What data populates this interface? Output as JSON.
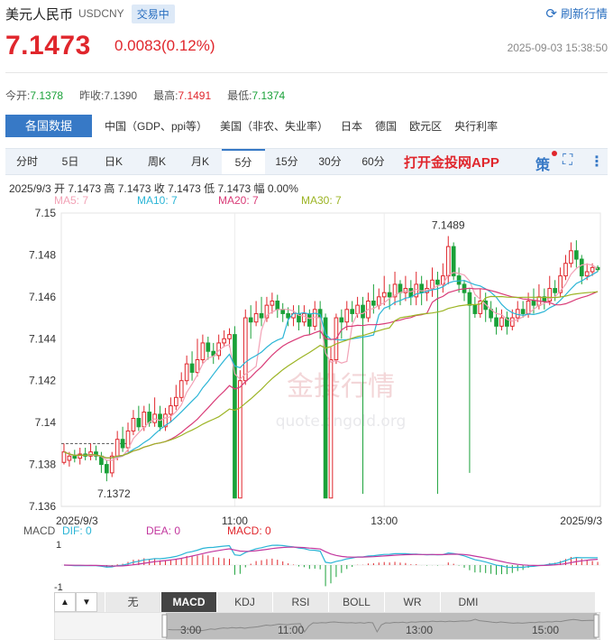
{
  "header": {
    "name": "美元人民币",
    "code": "USDCNY",
    "status": "交易中",
    "refresh_label": "刷新行情"
  },
  "quote": {
    "price": "7.1473",
    "change": "0.0083(0.12%)",
    "timestamp": "2025-09-03 15:38:50"
  },
  "stats": [
    {
      "label": "今开:",
      "value": "7.1378",
      "color": "green"
    },
    {
      "label": "昨收:",
      "value": "7.1390",
      "color": "neutral"
    },
    {
      "label": "最高:",
      "value": "7.1491",
      "color": "red"
    },
    {
      "label": "最低:",
      "value": "7.1374",
      "color": "green"
    }
  ],
  "data_tabs": {
    "active": "各国数据",
    "items": [
      "中国（GDP、ppi等）",
      "美国（非农、失业率）",
      "日本",
      "德国",
      "欧元区",
      "央行利率"
    ]
  },
  "periods": {
    "items": [
      "分时",
      "5日",
      "日K",
      "周K",
      "月K",
      "5分",
      "15分",
      "30分",
      "60分"
    ],
    "active_index": 5,
    "promo": "打开金投网APP",
    "strategy_label": "策"
  },
  "ohlc_line": "2025/9/3  开 7.1473  高 7.1473  收 7.1473  低 7.1473  幅 0.00%",
  "ma_legend": [
    {
      "label": "MA5: 7",
      "color": "#f2a2b6"
    },
    {
      "label": "MA10: 7",
      "color": "#2bb5d6"
    },
    {
      "label": "MA20: 7",
      "color": "#d93c78"
    },
    {
      "label": "MA30: 7",
      "color": "#9cb424"
    }
  ],
  "watermark": {
    "main": "金投行情",
    "sub": "quote.cngold.org"
  },
  "macd_legend": [
    {
      "label": "MACD",
      "color": "#555555"
    },
    {
      "label": "DIF: 0",
      "color": "#2bb5d6"
    },
    {
      "label": "DEA: 0",
      "color": "#c2379e"
    },
    {
      "label": "MACD: 0",
      "color": "#e0262c"
    }
  ],
  "macd_axis": [
    "1",
    "-1"
  ],
  "indicator_tabs": {
    "arrows": [
      "▲",
      "▼"
    ],
    "items": [
      "无",
      "MACD",
      "KDJ",
      "RSI",
      "BOLL",
      "WR",
      "DMI"
    ],
    "active_index": 1
  },
  "navigator": {
    "labels": [
      "3:00",
      "11:00",
      "13:00",
      "15:00"
    ]
  },
  "chart_data": {
    "type": "candlestick",
    "colors": {
      "up": "#e0262c",
      "down": "#1aa139"
    },
    "y_ticks": [
      "7.15",
      "7.148",
      "7.146",
      "7.144",
      "7.142",
      "7.14",
      "7.138",
      "7.136"
    ],
    "ylim": [
      7.136,
      7.15
    ],
    "x_tick_labels": [
      {
        "label": "2025/9/3",
        "index": 0
      },
      {
        "label": "11:00",
        "index": 32
      },
      {
        "label": "13:00",
        "index": 60
      },
      {
        "label": "2025/9/3",
        "index": 100
      }
    ],
    "annotations": [
      {
        "label": "7.1489",
        "value": 7.1489,
        "index": 72
      },
      {
        "label": "7.1372",
        "value": 7.1372,
        "index": 8
      }
    ],
    "reference_line": 7.139,
    "candles": [
      [
        7.1381,
        7.1386,
        7.139,
        7.138
      ],
      [
        7.1382,
        7.1384,
        7.1386,
        7.1379
      ],
      [
        7.1384,
        7.1383,
        7.1387,
        7.1381
      ],
      [
        7.1383,
        7.1385,
        7.1388,
        7.138
      ],
      [
        7.1385,
        7.1384,
        7.1388,
        7.1382
      ],
      [
        7.1384,
        7.1386,
        7.139,
        7.1382
      ],
      [
        7.1386,
        7.1384,
        7.1389,
        7.1382
      ],
      [
        7.1384,
        7.138,
        7.1386,
        7.1376
      ],
      [
        7.138,
        7.1376,
        7.1382,
        7.1372
      ],
      [
        7.1376,
        7.1384,
        7.1386,
        7.1374
      ],
      [
        7.1384,
        7.1392,
        7.1396,
        7.1382
      ],
      [
        7.1392,
        7.1388,
        7.1398,
        7.1386
      ],
      [
        7.1388,
        7.1396,
        7.14,
        7.1386
      ],
      [
        7.1396,
        7.1402,
        7.1406,
        7.1394
      ],
      [
        7.1402,
        7.1398,
        7.1408,
        7.1396
      ],
      [
        7.1398,
        7.1405,
        7.1408,
        7.1396
      ],
      [
        7.1405,
        7.14,
        7.1409,
        7.1398
      ],
      [
        7.14,
        7.1404,
        7.1412,
        7.1398
      ],
      [
        7.1404,
        7.1398,
        7.1408,
        7.1396
      ],
      [
        7.1398,
        7.1404,
        7.1407,
        7.1396
      ],
      [
        7.1404,
        7.1408,
        7.1412,
        7.14
      ],
      [
        7.1408,
        7.1412,
        7.1418,
        7.1406
      ],
      [
        7.1412,
        7.142,
        7.1424,
        7.141
      ],
      [
        7.142,
        7.1428,
        7.1432,
        7.1418
      ],
      [
        7.1428,
        7.1424,
        7.1434,
        7.142
      ],
      [
        7.1424,
        7.143,
        7.144,
        7.1422
      ],
      [
        7.143,
        7.1438,
        7.1442,
        7.1428
      ],
      [
        7.1438,
        7.1434,
        7.1441,
        7.143
      ],
      [
        7.1434,
        7.1432,
        7.1438,
        7.1428
      ],
      [
        7.1432,
        7.1438,
        7.1442,
        7.143
      ],
      [
        7.1438,
        7.144,
        7.1444,
        7.1436
      ],
      [
        7.144,
        7.1442,
        7.1445,
        7.1436
      ],
      [
        7.1442,
        7.1364,
        7.1446,
        7.1364
      ],
      [
        7.1364,
        7.142,
        7.1425,
        7.1364
      ],
      [
        7.142,
        7.145,
        7.1454,
        7.1418
      ],
      [
        7.145,
        7.1448,
        7.1456,
        7.144
      ],
      [
        7.1448,
        7.1452,
        7.1458,
        7.1446
      ],
      [
        7.1452,
        7.145,
        7.146,
        7.1446
      ],
      [
        7.145,
        7.1456,
        7.146,
        7.1448
      ],
      [
        7.1456,
        7.1458,
        7.1462,
        7.1452
      ],
      [
        7.1458,
        7.1454,
        7.1461,
        7.145
      ],
      [
        7.1454,
        7.1452,
        7.1457,
        7.1448
      ],
      [
        7.1452,
        7.145,
        7.1455,
        7.1446
      ],
      [
        7.145,
        7.1452,
        7.1456,
        7.1446
      ],
      [
        7.1452,
        7.1448,
        7.1456,
        7.1444
      ],
      [
        7.1448,
        7.1452,
        7.1456,
        7.1446
      ],
      [
        7.1452,
        7.1446,
        7.1454,
        7.1442
      ],
      [
        7.1446,
        7.1454,
        7.1458,
        7.1444
      ],
      [
        7.1454,
        7.145,
        7.1458,
        7.144
      ],
      [
        7.145,
        7.1364,
        7.1452,
        7.1364
      ],
      [
        7.1364,
        7.143,
        7.1436,
        7.1364
      ],
      [
        7.143,
        7.145,
        7.1452,
        7.1428
      ],
      [
        7.145,
        7.1448,
        7.1454,
        7.144
      ],
      [
        7.1448,
        7.1454,
        7.1458,
        7.1444
      ],
      [
        7.1454,
        7.1452,
        7.1458,
        7.1448
      ],
      [
        7.1452,
        7.1456,
        7.146,
        7.145
      ],
      [
        7.1456,
        7.145,
        7.146,
        7.1366
      ],
      [
        7.145,
        7.1458,
        7.1462,
        7.1448
      ],
      [
        7.1458,
        7.1456,
        7.1466,
        7.1452
      ],
      [
        7.1456,
        7.146,
        7.1464,
        7.1454
      ],
      [
        7.146,
        7.1462,
        7.147,
        7.1456
      ],
      [
        7.1462,
        7.146,
        7.1466,
        7.1454
      ],
      [
        7.146,
        7.1466,
        7.1472,
        7.1456
      ],
      [
        7.1466,
        7.1462,
        7.1468,
        7.1456
      ],
      [
        7.1462,
        7.1464,
        7.147,
        7.1458
      ],
      [
        7.1464,
        7.146,
        7.1468,
        7.1456
      ],
      [
        7.146,
        7.1466,
        7.1472,
        7.1456
      ],
      [
        7.1466,
        7.1462,
        7.147,
        7.1456
      ],
      [
        7.1462,
        7.1464,
        7.1468,
        7.1458
      ],
      [
        7.1464,
        7.1468,
        7.1474,
        7.146
      ],
      [
        7.1468,
        7.1466,
        7.1472,
        7.1366
      ],
      [
        7.1466,
        7.147,
        7.1476,
        7.1462
      ],
      [
        7.147,
        7.1484,
        7.1489,
        7.1466
      ],
      [
        7.1484,
        7.147,
        7.1486,
        7.1468
      ],
      [
        7.147,
        7.1466,
        7.1474,
        7.1462
      ],
      [
        7.1466,
        7.1462,
        7.1468,
        7.1458
      ],
      [
        7.1462,
        7.1456,
        7.1464,
        7.1376
      ],
      [
        7.1456,
        7.1452,
        7.146,
        7.145
      ],
      [
        7.1452,
        7.1458,
        7.1464,
        7.145
      ],
      [
        7.1458,
        7.1454,
        7.1462,
        7.1448
      ],
      [
        7.1454,
        7.145,
        7.1458,
        7.1448
      ],
      [
        7.145,
        7.1446,
        7.1455,
        7.1442
      ],
      [
        7.1446,
        7.145,
        7.1454,
        7.1444
      ],
      [
        7.145,
        7.1446,
        7.1453,
        7.1442
      ],
      [
        7.1446,
        7.145,
        7.1454,
        7.1444
      ],
      [
        7.145,
        7.1454,
        7.1458,
        7.1448
      ],
      [
        7.1454,
        7.1452,
        7.1458,
        7.145
      ],
      [
        7.1452,
        7.1458,
        7.1462,
        7.145
      ],
      [
        7.1458,
        7.1456,
        7.1464,
        7.1452
      ],
      [
        7.1456,
        7.146,
        7.1466,
        7.1454
      ],
      [
        7.146,
        7.1458,
        7.1464,
        7.1454
      ],
      [
        7.1458,
        7.1464,
        7.147,
        7.1456
      ],
      [
        7.1464,
        7.1462,
        7.1468,
        7.1458
      ],
      [
        7.1462,
        7.147,
        7.1474,
        7.146
      ],
      [
        7.147,
        7.1476,
        7.148,
        7.1468
      ],
      [
        7.1476,
        7.1482,
        7.1486,
        7.1474
      ],
      [
        7.1482,
        7.1478,
        7.1487,
        7.1474
      ],
      [
        7.1478,
        7.147,
        7.148,
        7.1466
      ],
      [
        7.147,
        7.1472,
        7.1476,
        7.1468
      ],
      [
        7.1472,
        7.1474,
        7.1476,
        7.147
      ],
      [
        7.1474,
        7.1473,
        7.1475,
        7.1472
      ]
    ]
  }
}
